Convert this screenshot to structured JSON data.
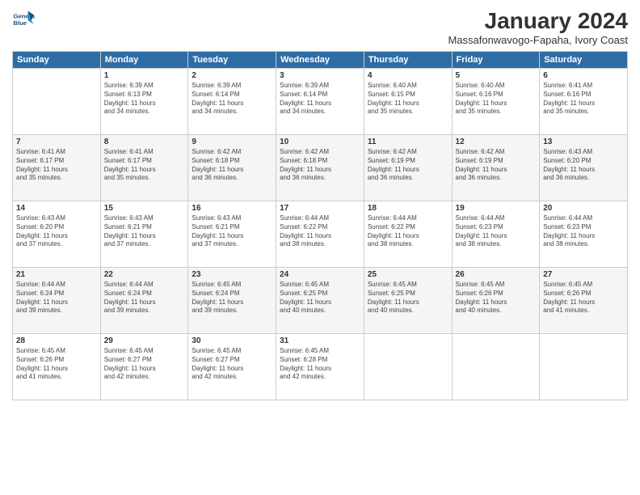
{
  "header": {
    "logo_line1": "General",
    "logo_line2": "Blue",
    "month": "January 2024",
    "location": "Massafonwavogo-Fapaha, Ivory Coast"
  },
  "weekdays": [
    "Sunday",
    "Monday",
    "Tuesday",
    "Wednesday",
    "Thursday",
    "Friday",
    "Saturday"
  ],
  "weeks": [
    [
      {
        "day": "",
        "text": ""
      },
      {
        "day": "1",
        "text": "Sunrise: 6:39 AM\nSunset: 6:13 PM\nDaylight: 11 hours\nand 34 minutes."
      },
      {
        "day": "2",
        "text": "Sunrise: 6:39 AM\nSunset: 6:14 PM\nDaylight: 11 hours\nand 34 minutes."
      },
      {
        "day": "3",
        "text": "Sunrise: 6:39 AM\nSunset: 6:14 PM\nDaylight: 11 hours\nand 34 minutes."
      },
      {
        "day": "4",
        "text": "Sunrise: 6:40 AM\nSunset: 6:15 PM\nDaylight: 11 hours\nand 35 minutes."
      },
      {
        "day": "5",
        "text": "Sunrise: 6:40 AM\nSunset: 6:16 PM\nDaylight: 11 hours\nand 35 minutes."
      },
      {
        "day": "6",
        "text": "Sunrise: 6:41 AM\nSunset: 6:16 PM\nDaylight: 11 hours\nand 35 minutes."
      }
    ],
    [
      {
        "day": "7",
        "text": "Sunrise: 6:41 AM\nSunset: 6:17 PM\nDaylight: 11 hours\nand 35 minutes."
      },
      {
        "day": "8",
        "text": "Sunrise: 6:41 AM\nSunset: 6:17 PM\nDaylight: 11 hours\nand 35 minutes."
      },
      {
        "day": "9",
        "text": "Sunrise: 6:42 AM\nSunset: 6:18 PM\nDaylight: 11 hours\nand 36 minutes."
      },
      {
        "day": "10",
        "text": "Sunrise: 6:42 AM\nSunset: 6:18 PM\nDaylight: 11 hours\nand 36 minutes."
      },
      {
        "day": "11",
        "text": "Sunrise: 6:42 AM\nSunset: 6:19 PM\nDaylight: 11 hours\nand 36 minutes."
      },
      {
        "day": "12",
        "text": "Sunrise: 6:42 AM\nSunset: 6:19 PM\nDaylight: 11 hours\nand 36 minutes."
      },
      {
        "day": "13",
        "text": "Sunrise: 6:43 AM\nSunset: 6:20 PM\nDaylight: 11 hours\nand 36 minutes."
      }
    ],
    [
      {
        "day": "14",
        "text": "Sunrise: 6:43 AM\nSunset: 6:20 PM\nDaylight: 11 hours\nand 37 minutes."
      },
      {
        "day": "15",
        "text": "Sunrise: 6:43 AM\nSunset: 6:21 PM\nDaylight: 11 hours\nand 37 minutes."
      },
      {
        "day": "16",
        "text": "Sunrise: 6:43 AM\nSunset: 6:21 PM\nDaylight: 11 hours\nand 37 minutes."
      },
      {
        "day": "17",
        "text": "Sunrise: 6:44 AM\nSunset: 6:22 PM\nDaylight: 11 hours\nand 38 minutes."
      },
      {
        "day": "18",
        "text": "Sunrise: 6:44 AM\nSunset: 6:22 PM\nDaylight: 11 hours\nand 38 minutes."
      },
      {
        "day": "19",
        "text": "Sunrise: 6:44 AM\nSunset: 6:23 PM\nDaylight: 11 hours\nand 38 minutes."
      },
      {
        "day": "20",
        "text": "Sunrise: 6:44 AM\nSunset: 6:23 PM\nDaylight: 11 hours\nand 38 minutes."
      }
    ],
    [
      {
        "day": "21",
        "text": "Sunrise: 6:44 AM\nSunset: 6:24 PM\nDaylight: 11 hours\nand 39 minutes."
      },
      {
        "day": "22",
        "text": "Sunrise: 6:44 AM\nSunset: 6:24 PM\nDaylight: 11 hours\nand 39 minutes."
      },
      {
        "day": "23",
        "text": "Sunrise: 6:45 AM\nSunset: 6:24 PM\nDaylight: 11 hours\nand 39 minutes."
      },
      {
        "day": "24",
        "text": "Sunrise: 6:45 AM\nSunset: 6:25 PM\nDaylight: 11 hours\nand 40 minutes."
      },
      {
        "day": "25",
        "text": "Sunrise: 6:45 AM\nSunset: 6:25 PM\nDaylight: 11 hours\nand 40 minutes."
      },
      {
        "day": "26",
        "text": "Sunrise: 6:45 AM\nSunset: 6:26 PM\nDaylight: 11 hours\nand 40 minutes."
      },
      {
        "day": "27",
        "text": "Sunrise: 6:45 AM\nSunset: 6:26 PM\nDaylight: 11 hours\nand 41 minutes."
      }
    ],
    [
      {
        "day": "28",
        "text": "Sunrise: 6:45 AM\nSunset: 6:26 PM\nDaylight: 11 hours\nand 41 minutes."
      },
      {
        "day": "29",
        "text": "Sunrise: 6:45 AM\nSunset: 6:27 PM\nDaylight: 11 hours\nand 42 minutes."
      },
      {
        "day": "30",
        "text": "Sunrise: 6:45 AM\nSunset: 6:27 PM\nDaylight: 11 hours\nand 42 minutes."
      },
      {
        "day": "31",
        "text": "Sunrise: 6:45 AM\nSunset: 6:28 PM\nDaylight: 11 hours\nand 42 minutes."
      },
      {
        "day": "",
        "text": ""
      },
      {
        "day": "",
        "text": ""
      },
      {
        "day": "",
        "text": ""
      }
    ]
  ]
}
